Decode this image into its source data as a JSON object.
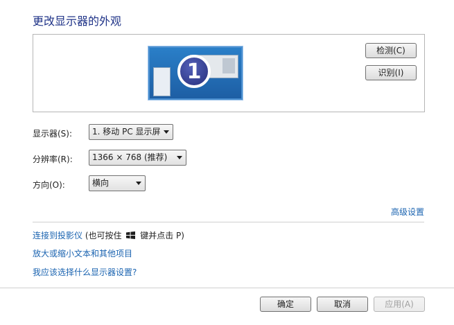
{
  "title": "更改显示器的外观",
  "preview": {
    "monitor_number": "1"
  },
  "buttons": {
    "detect": "检测(C)",
    "identify": "识别(I)"
  },
  "display": {
    "label": "显示器(S):",
    "value": "1. 移动 PC 显示屏"
  },
  "resolution": {
    "label": "分辨率(R):",
    "value": "1366 × 768 (推荐)"
  },
  "orientation": {
    "label": "方向(O):",
    "value": "横向"
  },
  "advanced_link": "高级设置",
  "links": {
    "projector": "连接到投影仪",
    "projector_hint_a": "(也可按住",
    "projector_hint_b": "键并点击 P)",
    "text_size": "放大或缩小文本和其他项目",
    "which_settings": "我应该选择什么显示器设置?"
  },
  "footer": {
    "ok": "确定",
    "cancel": "取消",
    "apply": "应用(A)"
  }
}
